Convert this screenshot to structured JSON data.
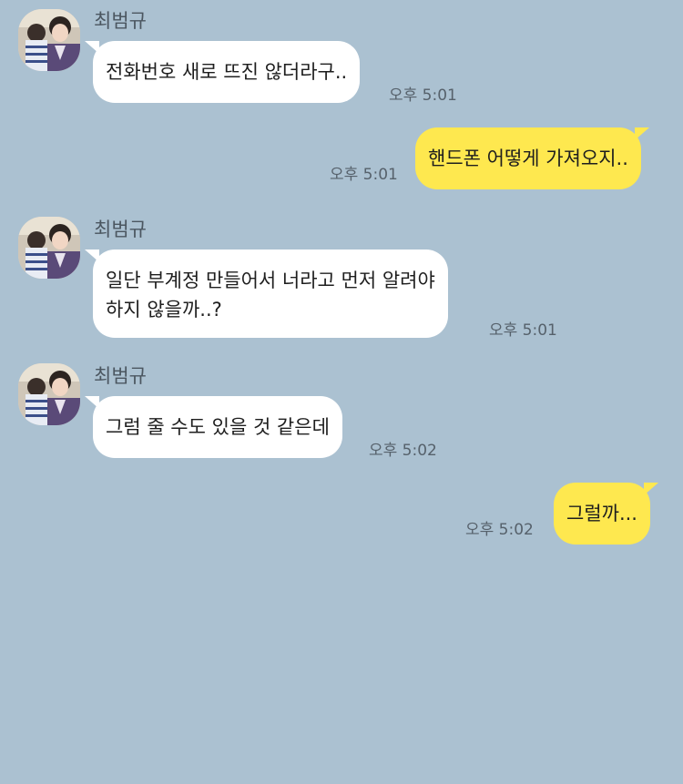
{
  "colors": {
    "background": "#abc1d1",
    "incoming_bubble": "#ffffff",
    "outgoing_bubble": "#fee84f"
  },
  "messages": [
    {
      "sender": "최범규",
      "direction": "incoming",
      "text": "전화번호 새로 뜨진 않더라구..",
      "time": "오후 5:01"
    },
    {
      "direction": "outgoing",
      "text": "핸드폰 어떻게 가져오지..",
      "time": "오후 5:01"
    },
    {
      "sender": "최범규",
      "direction": "incoming",
      "text": "일단 부계정 만들어서 너라고 먼저 알려야\n하지 않을까..?",
      "time": "오후 5:01"
    },
    {
      "sender": "최범규",
      "direction": "incoming",
      "text": "그럼 줄 수도 있을 것 같은데",
      "time": "오후 5:02"
    },
    {
      "direction": "outgoing",
      "text": "그럴까...",
      "time": "오후 5:02"
    }
  ]
}
